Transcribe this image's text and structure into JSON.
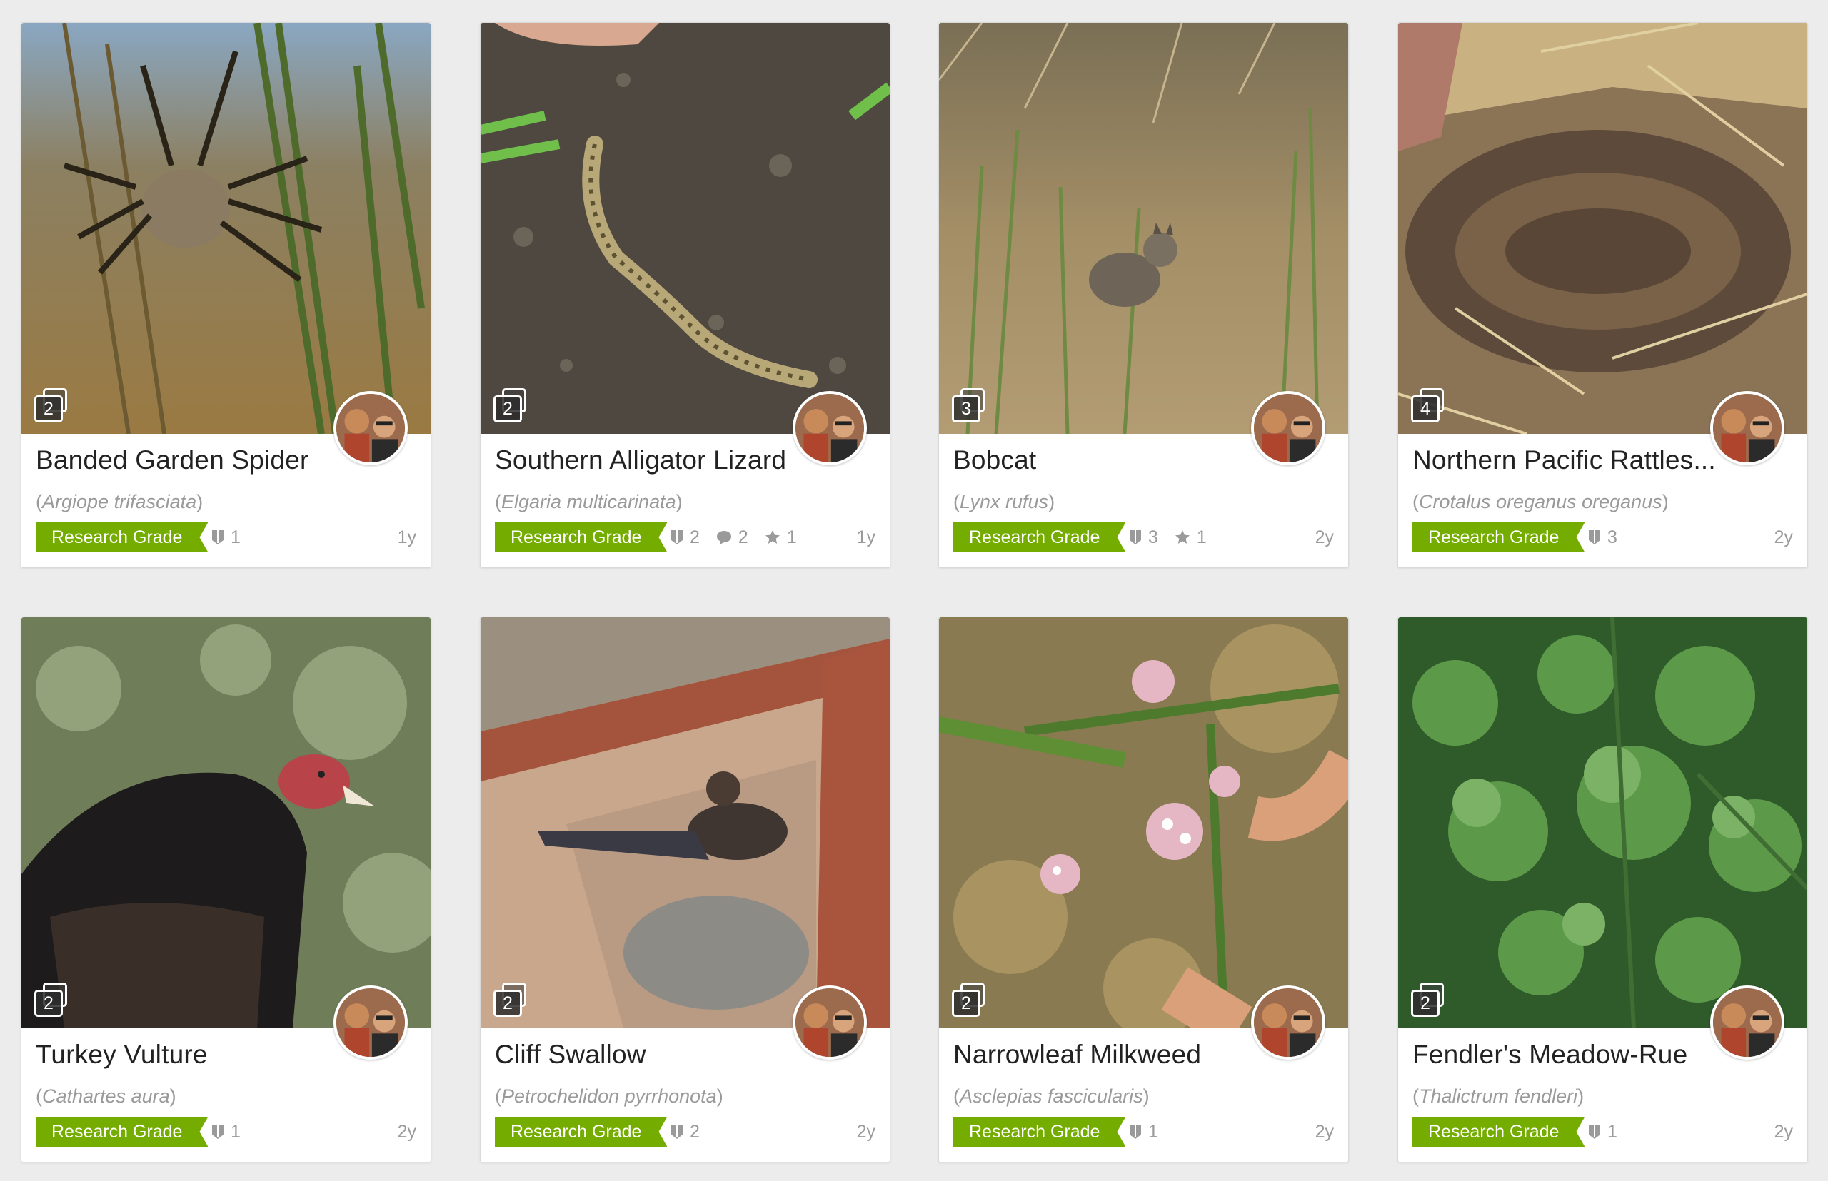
{
  "cards": [
    {
      "name": "Banded Garden Spider",
      "sci": "Argiope trifasciata",
      "grade": "Research Grade",
      "photos": "2",
      "ids": "1",
      "comments": "",
      "faves": "",
      "age": "1y"
    },
    {
      "name": "Southern Alligator Lizard",
      "sci": "Elgaria multicarinata",
      "grade": "Research Grade",
      "photos": "2",
      "ids": "2",
      "comments": "2",
      "faves": "1",
      "age": "1y"
    },
    {
      "name": "Bobcat",
      "sci": "Lynx rufus",
      "grade": "Research Grade",
      "photos": "3",
      "ids": "3",
      "comments": "",
      "faves": "1",
      "age": "2y"
    },
    {
      "name": "Northern Pacific Rattles...",
      "sci": "Crotalus oreganus oreganus",
      "grade": "Research Grade",
      "photos": "4",
      "ids": "3",
      "comments": "",
      "faves": "",
      "age": "2y"
    },
    {
      "name": "Turkey Vulture",
      "sci": "Cathartes aura",
      "grade": "Research Grade",
      "photos": "2",
      "ids": "1",
      "comments": "",
      "faves": "",
      "age": "2y"
    },
    {
      "name": "Cliff Swallow",
      "sci": "Petrochelidon pyrrhonota",
      "grade": "Research Grade",
      "photos": "2",
      "ids": "2",
      "comments": "",
      "faves": "",
      "age": "2y"
    },
    {
      "name": "Narrowleaf Milkweed",
      "sci": "Asclepias fascicularis",
      "grade": "Research Grade",
      "photos": "2",
      "ids": "1",
      "comments": "",
      "faves": "",
      "age": "2y"
    },
    {
      "name": "Fendler's Meadow-Rue",
      "sci": "Thalictrum fendleri",
      "grade": "Research Grade",
      "photos": "2",
      "ids": "1",
      "comments": "",
      "faves": "",
      "age": "2y"
    }
  ],
  "colors": {
    "grade": "#74ac00",
    "page_bg": "#ececec",
    "muted_text": "#9a9a9a"
  }
}
